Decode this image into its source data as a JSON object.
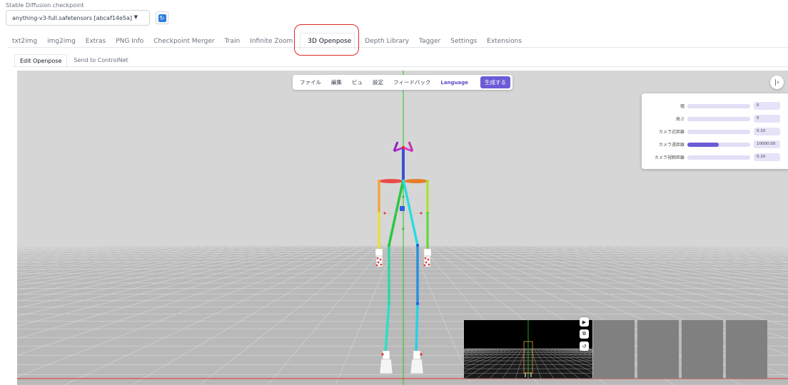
{
  "checkpoint": {
    "label": "Stable Diffusion checkpoint",
    "value": "anything-v3-full.safetensors [abcaf14e5a]",
    "refresh_icon": "refresh-icon"
  },
  "main_tabs": [
    {
      "label": "txt2img"
    },
    {
      "label": "img2img"
    },
    {
      "label": "Extras"
    },
    {
      "label": "PNG Info"
    },
    {
      "label": "Checkpoint Merger"
    },
    {
      "label": "Train"
    },
    {
      "label": "Infinite Zoom"
    },
    {
      "label": "3D Openpose"
    },
    {
      "label": "Depth Library"
    },
    {
      "label": "Tagger"
    },
    {
      "label": "Settings"
    },
    {
      "label": "Extensions"
    }
  ],
  "active_main_tab": "3D Openpose",
  "sub_tabs": [
    {
      "label": "Edit Openpose"
    },
    {
      "label": "Send to ControlNet"
    }
  ],
  "menubar": {
    "items": [
      "ファイル",
      "編集",
      "ビュ",
      "設定",
      "フィードバック"
    ],
    "language": "Language",
    "generate": "生成する"
  },
  "settings_panel": {
    "rows": [
      {
        "label": "幅",
        "value": "0",
        "fill": 0
      },
      {
        "label": "高さ",
        "value": "0",
        "fill": 0
      },
      {
        "label": "カメラ近距離",
        "value": "0.10",
        "fill": 0
      },
      {
        "label": "カメラ遠距離",
        "value": "10000.00",
        "fill": 0.5
      },
      {
        "label": "カメラ視野距離",
        "value": "0.10",
        "fill": 0
      }
    ]
  },
  "colors": {
    "accent": "#6b5bd6",
    "highlight": "#e0282a",
    "viewport_bg": "#d6d6d6",
    "floor": "#b8b8b8"
  },
  "thumbnail_controls": [
    "play-icon",
    "screenshot-icon",
    "undo-icon"
  ]
}
